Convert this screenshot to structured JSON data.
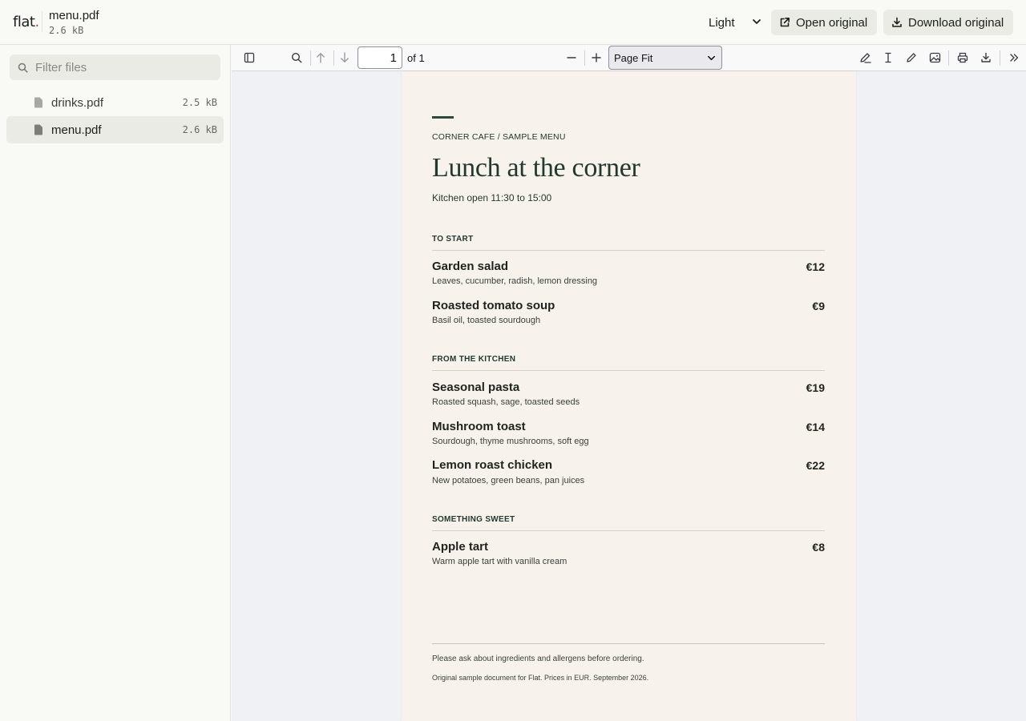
{
  "header": {
    "brand": "flat",
    "brand_dot": ".",
    "file_title": "menu.pdf",
    "file_size": "2.6 kB",
    "theme": "Light",
    "open_label": "Open original",
    "download_label": "Download original"
  },
  "sidebar": {
    "filter_placeholder": "Filter files",
    "files": [
      {
        "name": "drinks.pdf",
        "size": "2.5 kB",
        "active": false
      },
      {
        "name": "menu.pdf",
        "size": "2.6 kB",
        "active": true
      }
    ]
  },
  "toolbar": {
    "page_value": "1",
    "page_of": "of 1",
    "zoom": "Page Fit"
  },
  "document": {
    "eyebrow": "CORNER CAFE / SAMPLE MENU",
    "headline": "Lunch at the corner",
    "hours": "Kitchen open 11:30 to 15:00",
    "sections": [
      {
        "title": "TO START",
        "items": [
          {
            "name": "Garden salad",
            "price": "€12",
            "desc": "Leaves, cucumber, radish, lemon dressing"
          },
          {
            "name": "Roasted tomato soup",
            "price": "€9",
            "desc": "Basil oil, toasted sourdough"
          }
        ]
      },
      {
        "title": "FROM THE KITCHEN",
        "items": [
          {
            "name": "Seasonal pasta",
            "price": "€19",
            "desc": "Roasted squash, sage, toasted seeds"
          },
          {
            "name": "Mushroom toast",
            "price": "€14",
            "desc": "Sourdough, thyme mushrooms, soft egg"
          },
          {
            "name": "Lemon roast chicken",
            "price": "€22",
            "desc": "New potatoes, green beans, pan juices"
          }
        ]
      },
      {
        "title": "SOMETHING SWEET",
        "items": [
          {
            "name": "Apple tart",
            "price": "€8",
            "desc": "Warm apple tart with vanilla cream"
          }
        ]
      }
    ],
    "footer_note": "Please ask about ingredients and allergens before ordering.",
    "footer_small": "Original sample document for Flat. Prices in EUR. September 2026."
  },
  "colors": {
    "accent_dot": "#d94040",
    "menu_green": "#23392f",
    "page_bg": "#f7f3ec"
  }
}
